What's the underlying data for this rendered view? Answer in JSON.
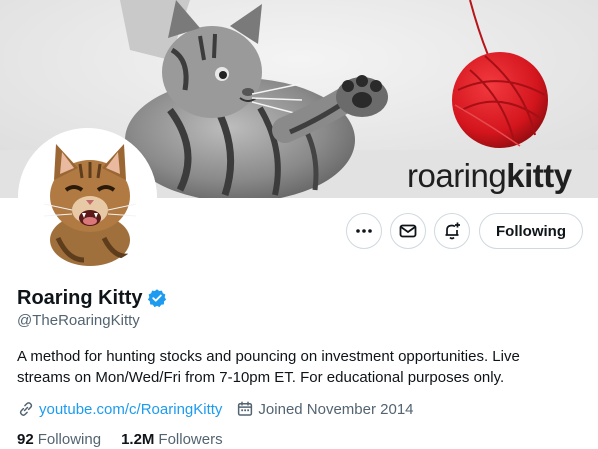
{
  "banner": {
    "brand_light": "roaring",
    "brand_bold": "kitty",
    "image_icon": "kitten-yarn-banner"
  },
  "avatar": {
    "icon": "hissing-kitten-avatar"
  },
  "actions": {
    "more_icon": "more-dots-icon",
    "message_icon": "envelope-icon",
    "notify_icon": "bell-plus-icon",
    "follow_label": "Following"
  },
  "profile": {
    "name": "Roaring Kitty",
    "handle": "@TheRoaringKitty",
    "bio": "A method for hunting stocks and pouncing on investment opportunities. Live streams on Mon/Wed/Fri from 7-10pm ET. For educational purposes only.",
    "link": "youtube.com/c/RoaringKitty",
    "joined": "Joined November 2014"
  },
  "stats": {
    "following_count": "92",
    "following_label": "Following",
    "followers_count": "1.2M",
    "followers_label": "Followers"
  },
  "colors": {
    "accent": "#1d9bf0",
    "muted": "#536471",
    "text": "#0f1419",
    "border": "#cfd9de",
    "yarn": "#d4151d"
  }
}
